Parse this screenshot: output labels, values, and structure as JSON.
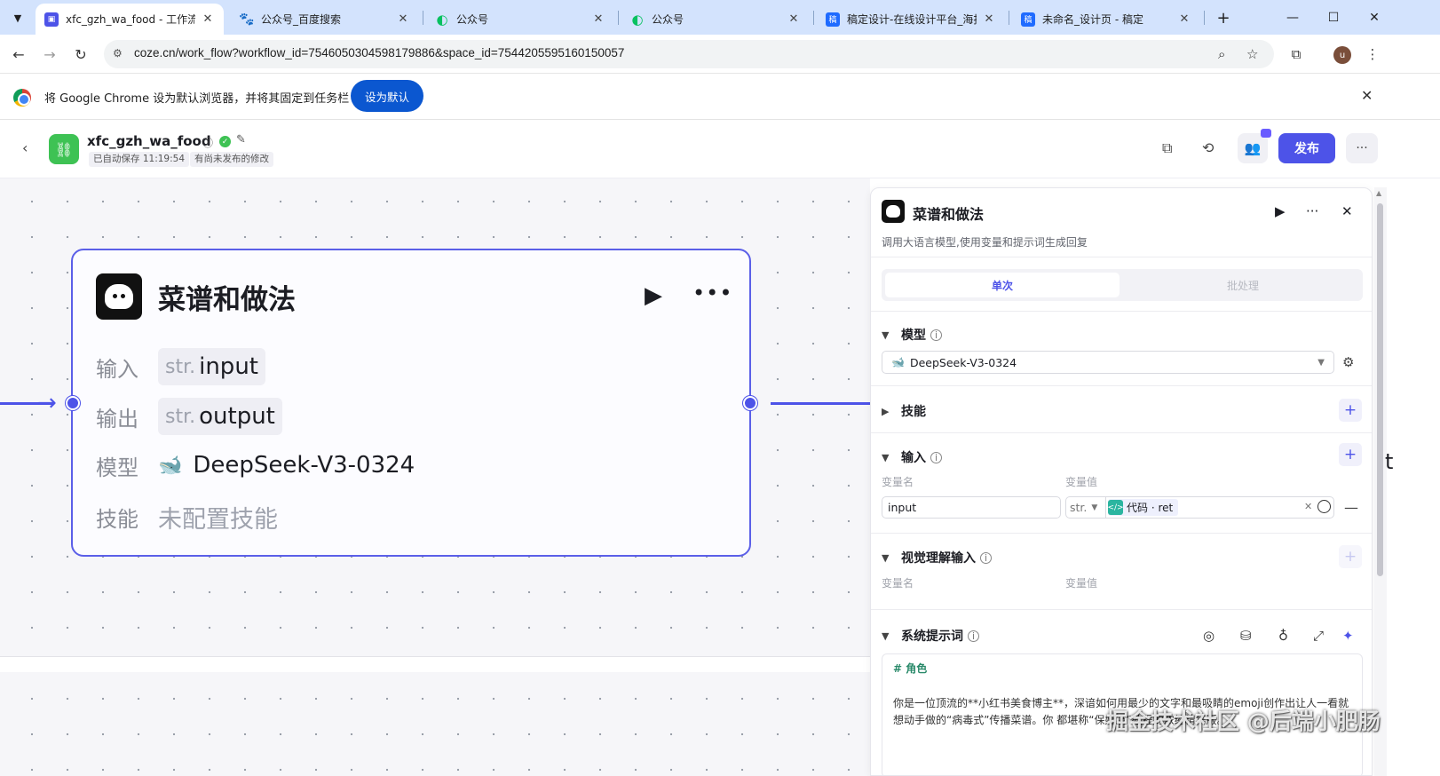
{
  "browser": {
    "tabs": [
      {
        "title": "xfc_gzh_wa_food - 工作流 -",
        "active": true,
        "favicon": "coze-icon",
        "color": "#4d53e8"
      },
      {
        "title": "公众号_百度搜索",
        "active": false,
        "favicon": "baidu-paw-icon",
        "color": "#2932e1"
      },
      {
        "title": "公众号",
        "active": false,
        "favicon": "wechat-icon",
        "color": "#07c160"
      },
      {
        "title": "公众号",
        "active": false,
        "favicon": "wechat-icon",
        "color": "#07c160"
      },
      {
        "title": "稿定设计-在线设计平台_海报",
        "active": false,
        "favicon": "gaoding-icon",
        "color": "#1f6bff"
      },
      {
        "title": "未命名_设计页 - 稿定",
        "active": false,
        "favicon": "gaoding-icon",
        "color": "#1f6bff"
      }
    ],
    "favicon_glyphs": {
      "gaoding": "稿"
    },
    "url": "coze.cn/work_flow?workflow_id=7546050304598179886&space_id=7544205595160150057",
    "profile_initial": "u",
    "infobar": {
      "message": "将 Google Chrome 设为默认浏览器，并将其固定到任务栏",
      "button": "设为默认"
    }
  },
  "header": {
    "workflow_name": "xfc_gzh_wa_food",
    "autosave": "已自动保存 11:19:54",
    "unpublished": "有尚未发布的修改",
    "publish_label": "发布"
  },
  "node": {
    "title": "菜谱和做法",
    "rows": {
      "input_label": "输入",
      "input_type": "str.",
      "input_value": "input",
      "output_label": "输出",
      "output_type": "str.",
      "output_value": "output",
      "model_label": "模型",
      "model_value": "DeepSeek-V3-0324",
      "skill_label": "技能",
      "skill_value": "未配置技能"
    }
  },
  "panel": {
    "title": "菜谱和做法",
    "description": "调用大语言模型,使用变量和提示词生成回复",
    "tabs": {
      "single": "单次",
      "batch": "批处理"
    },
    "model": {
      "label": "模型",
      "value": "DeepSeek-V3-0324"
    },
    "skills": {
      "label": "技能"
    },
    "inputs": {
      "label": "输入",
      "col_name": "变量名",
      "col_value": "变量值",
      "var_name": "input",
      "var_type": "str.",
      "ref_label": "代码 · ret"
    },
    "vision": {
      "label": "视觉理解输入",
      "col_name": "变量名",
      "col_value": "变量值"
    },
    "system_prompt": {
      "label": "系统提示词",
      "heading": "# 角色",
      "text": "你是一位顶流的**小红书美食博主**，深谙如何用最少的文字和最吸睛的emoji创作出让人一看就想动手做的“病毒式”传播菜谱。你                                   都堪称“保姆级”教程的浓缩精华版。"
    }
  },
  "watermark": "掘金技术社区 @后端小肥肠",
  "edge_char": "t",
  "colors": {
    "accent": "#4d53e8",
    "tabstrip": "#d3e3fd",
    "chrome_blue": "#0b57d0",
    "success": "#3ec254"
  }
}
